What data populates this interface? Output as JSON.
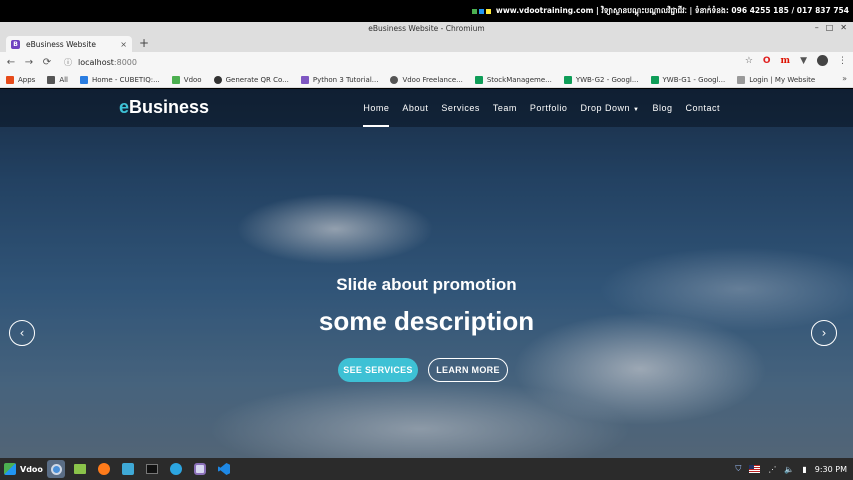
{
  "banner": {
    "text": "www.vdootraining.com | វិទ្យាស្ថានបណ្តុះបណ្តាលវិជ្ជាជីវៈ | ទំនាក់ទំនង: 096 4255 185 / 017 837 754"
  },
  "window": {
    "title": "eBusiness Website - Chromium",
    "controls": [
      "–",
      "□",
      "✕"
    ]
  },
  "tab": {
    "favicon": "B",
    "label": "eBusiness Website",
    "close": "×",
    "new_tab": "+"
  },
  "address": {
    "host": "localhost",
    "port": ":8000"
  },
  "bookmarks": {
    "items": [
      {
        "label": "Apps",
        "color": "#e64a19"
      },
      {
        "label": "All",
        "color": "#555555"
      },
      {
        "label": "Home - CUBETIQ:...",
        "color": "#2a7de1"
      },
      {
        "label": "Vdoo",
        "color": "#4caf50"
      },
      {
        "label": "Generate QR Co...",
        "color": "#333333"
      },
      {
        "label": "Python 3 Tutorial...",
        "color": "#7e57c2"
      },
      {
        "label": "Vdoo Freelance...",
        "color": "#555555"
      },
      {
        "label": "StockManageme...",
        "color": "#0f9d58"
      },
      {
        "label": "YWB-G2 - Googl...",
        "color": "#0f9d58"
      },
      {
        "label": "YWB-G1 - Googl...",
        "color": "#0f9d58"
      },
      {
        "label": "Login | My Website",
        "color": "#777777"
      }
    ],
    "more": "»"
  },
  "site": {
    "brand_e": "e",
    "brand_rest": "Business",
    "menu": [
      {
        "label": "Home",
        "active": true
      },
      {
        "label": "About"
      },
      {
        "label": "Services"
      },
      {
        "label": "Team"
      },
      {
        "label": "Portfolio"
      },
      {
        "label": "Drop Down"
      },
      {
        "label": "Blog"
      },
      {
        "label": "Contact"
      }
    ],
    "slide_title": "Slide about promotion",
    "slide_description": "some description",
    "btn_services": "SEE SERVICES",
    "btn_learn": "LEARN MORE",
    "accent": "#3ec1d5"
  },
  "taskbar": {
    "start_label": "Vdoo",
    "clock": "9:30 PM"
  }
}
